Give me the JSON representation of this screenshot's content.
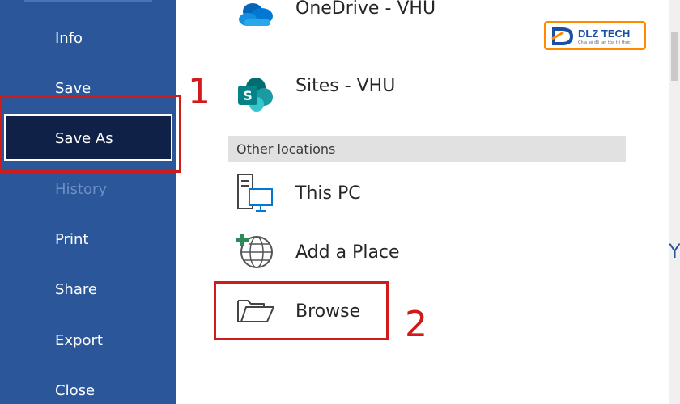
{
  "sidebar": {
    "items": [
      {
        "label": "Info"
      },
      {
        "label": "Save"
      },
      {
        "label": "Save As"
      },
      {
        "label": "History"
      },
      {
        "label": "Print"
      },
      {
        "label": "Share"
      },
      {
        "label": "Export"
      },
      {
        "label": "Close"
      }
    ]
  },
  "locations": {
    "onedrive": "OneDrive - VHU",
    "sites": "Sites - VHU",
    "section_header": "Other locations",
    "this_pc": "This PC",
    "add_place": "Add a Place",
    "browse": "Browse"
  },
  "annotations": {
    "step1": "1",
    "step2": "2"
  },
  "logo": {
    "text": "DLZ TECH",
    "tagline": "Chia sẻ để lan tỏa tri thức"
  },
  "edge_letter": "Y",
  "colors": {
    "sidebar": "#2b579a",
    "selected": "#0f2147",
    "annotation": "#d11a1a",
    "logo_border": "#ff8a00"
  }
}
